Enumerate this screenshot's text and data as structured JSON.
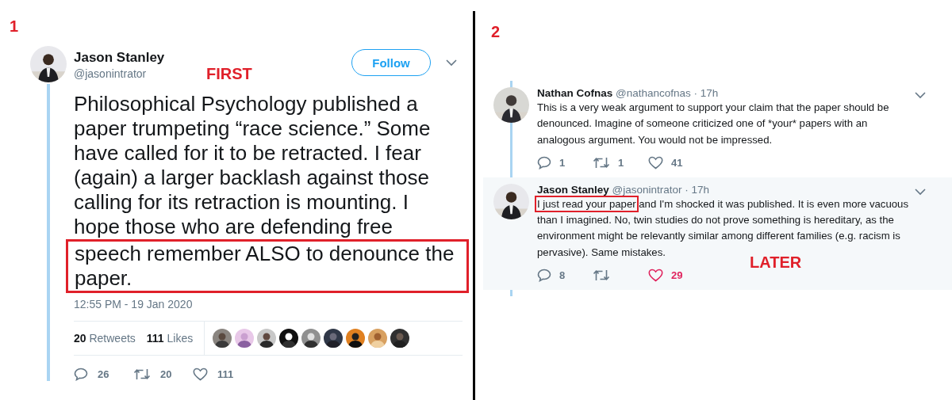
{
  "panels": [
    {
      "number": "1",
      "annotation": "FIRST",
      "tweet": {
        "name": "Jason Stanley",
        "handle": "@jasonintrator",
        "follow_button": "Follow",
        "body_parts": [
          {
            "text": "Philosophical Psychology published a paper trumpeting “race science.” Some have called for it to be retracted. I fear (again) a larger backlash against those calling for its retraction is mounting. I hope those who are defending free",
            "highlighted": false
          },
          {
            "text": "speech remember ALSO to denounce the paper.",
            "highlighted": true
          }
        ],
        "timestamp": "12:55 PM - 19 Jan 2020",
        "stats": [
          {
            "count": "20",
            "label": "Retweets"
          },
          {
            "count": "111",
            "label": "Likes"
          }
        ],
        "actions": {
          "replies": "26",
          "retweets": "20",
          "likes": "111",
          "liked": false
        }
      }
    },
    {
      "number": "2",
      "annotation": "LATER",
      "replies": [
        {
          "name": "Nathan Cofnas",
          "handle": "@nathancofnas",
          "time": "· 17h",
          "shaded": false,
          "body_parts": [
            {
              "text": "This is a very weak argument to support your claim that the paper should be denounced. Imagine of someone criticized one of *your* papers with an analogous argument. You would not be impressed.",
              "highlighted": false
            }
          ],
          "actions": {
            "replies": "1",
            "retweets": "1",
            "likes": "41",
            "liked": false
          }
        },
        {
          "name": "Jason Stanley",
          "handle": "@jasonintrator",
          "time": "· 17h",
          "shaded": true,
          "body_parts": [
            {
              "text": "I just read your paper",
              "highlighted": true
            },
            {
              "text": " and I'm shocked it was published. It is even more vacuous than I imagined. No, twin studies do not prove something is hereditary, as the environment might be relevantly similar among different families (e.g. racism is pervasive). Same mistakes.",
              "highlighted": false
            }
          ],
          "actions": {
            "replies": "8",
            "likes": "29",
            "liked": true
          }
        }
      ]
    }
  ]
}
